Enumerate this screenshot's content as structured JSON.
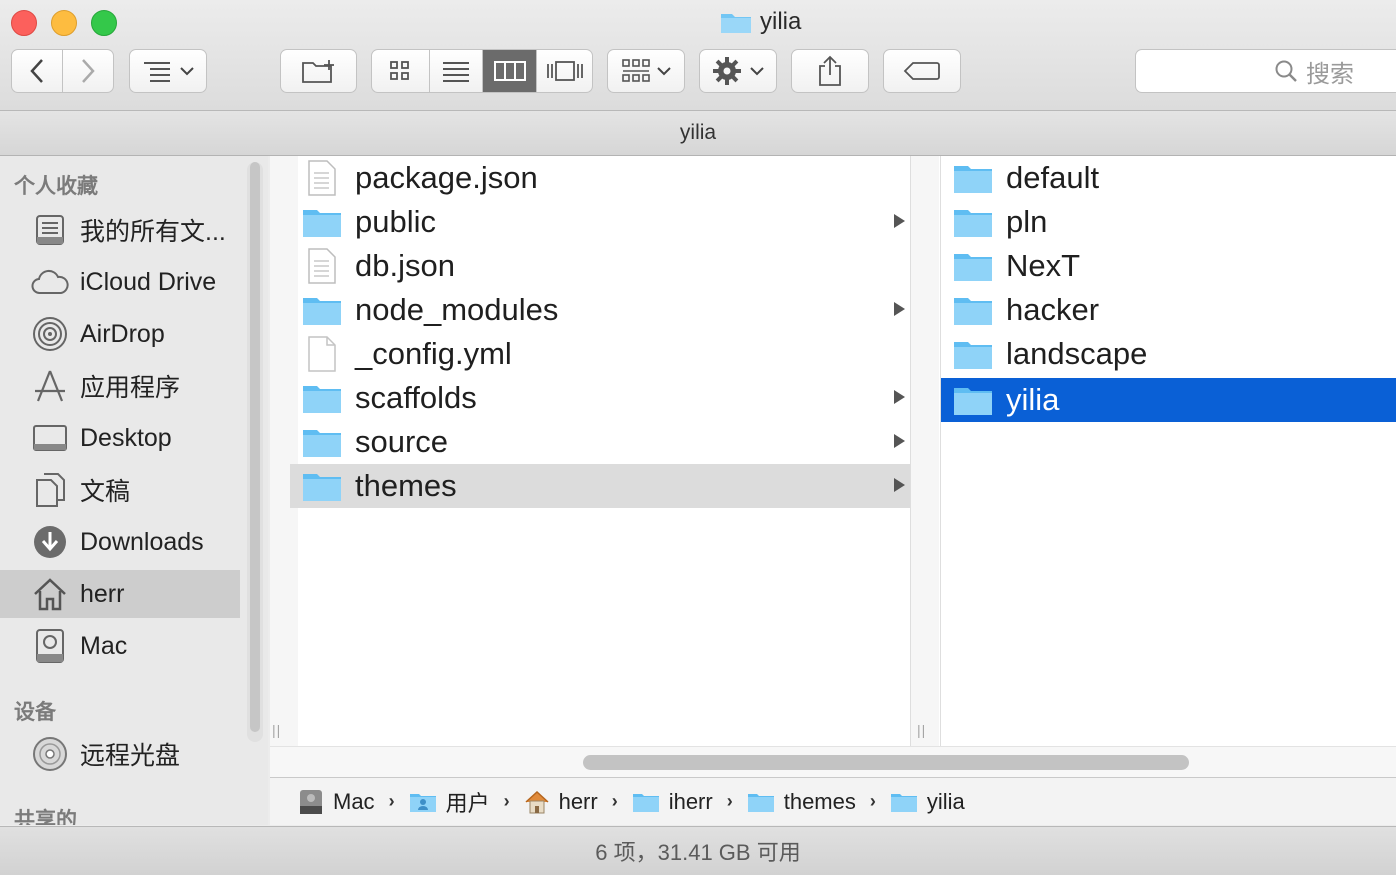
{
  "window": {
    "title": "yilia",
    "traffic_lights": {
      "close": "#fc605c",
      "minimize": "#fdbc40",
      "zoom": "#34c84a"
    }
  },
  "toolbar": {
    "icons": [
      "chevron-left-icon",
      "chevron-right-icon",
      "arrange-list-icon",
      "new-folder-icon",
      "icon-view-icon",
      "list-view-icon",
      "column-view-icon",
      "cover-flow-icon",
      "group-icon",
      "gear-icon",
      "share-icon",
      "tag-icon"
    ],
    "active_view": "columns",
    "search_placeholder": "搜索"
  },
  "path_title": "yilia",
  "sidebar": {
    "favorites_heading": "个人收藏",
    "favorites": [
      {
        "label": "我的所有文...",
        "icon": "all-files-icon"
      },
      {
        "label": "iCloud Drive",
        "icon": "cloud-icon"
      },
      {
        "label": "AirDrop",
        "icon": "airdrop-icon"
      },
      {
        "label": "应用程序",
        "icon": "applications-icon"
      },
      {
        "label": "Desktop",
        "icon": "desktop-icon"
      },
      {
        "label": "文稿",
        "icon": "documents-icon"
      },
      {
        "label": "Downloads",
        "icon": "downloads-icon"
      },
      {
        "label": "herr",
        "icon": "home-icon",
        "selected": true
      },
      {
        "label": "Mac",
        "icon": "disk-icon"
      }
    ],
    "devices_heading": "设备",
    "devices": [
      {
        "label": "远程光盘",
        "icon": "remote-disc-icon"
      }
    ],
    "shared_heading": "共享的"
  },
  "column1": [
    {
      "name": "package.json",
      "type": "file"
    },
    {
      "name": "public",
      "type": "folder"
    },
    {
      "name": "db.json",
      "type": "file"
    },
    {
      "name": "node_modules",
      "type": "folder"
    },
    {
      "name": "_config.yml",
      "type": "blank"
    },
    {
      "name": "scaffolds",
      "type": "folder"
    },
    {
      "name": "source",
      "type": "folder"
    },
    {
      "name": "themes",
      "type": "folder",
      "selected": true
    }
  ],
  "column2": [
    {
      "name": "default"
    },
    {
      "name": "pln"
    },
    {
      "name": "NexT"
    },
    {
      "name": "hacker"
    },
    {
      "name": "landscape"
    },
    {
      "name": "yilia",
      "selected": true
    }
  ],
  "breadcrumb": [
    {
      "label": "Mac",
      "icon": "disk-icon"
    },
    {
      "label": "用户",
      "icon": "users-folder-icon"
    },
    {
      "label": "herr",
      "icon": "home-icon"
    },
    {
      "label": "iherr",
      "icon": "folder-icon"
    },
    {
      "label": "themes",
      "icon": "folder-icon"
    },
    {
      "label": "yilia",
      "icon": "folder-icon"
    }
  ],
  "status": "6 项，31.41 GB 可用",
  "colors": {
    "selection_blue": "#0a60d6",
    "folder_blue": "#6cc4f5",
    "sidebar_bg": "#e9e9e9"
  }
}
